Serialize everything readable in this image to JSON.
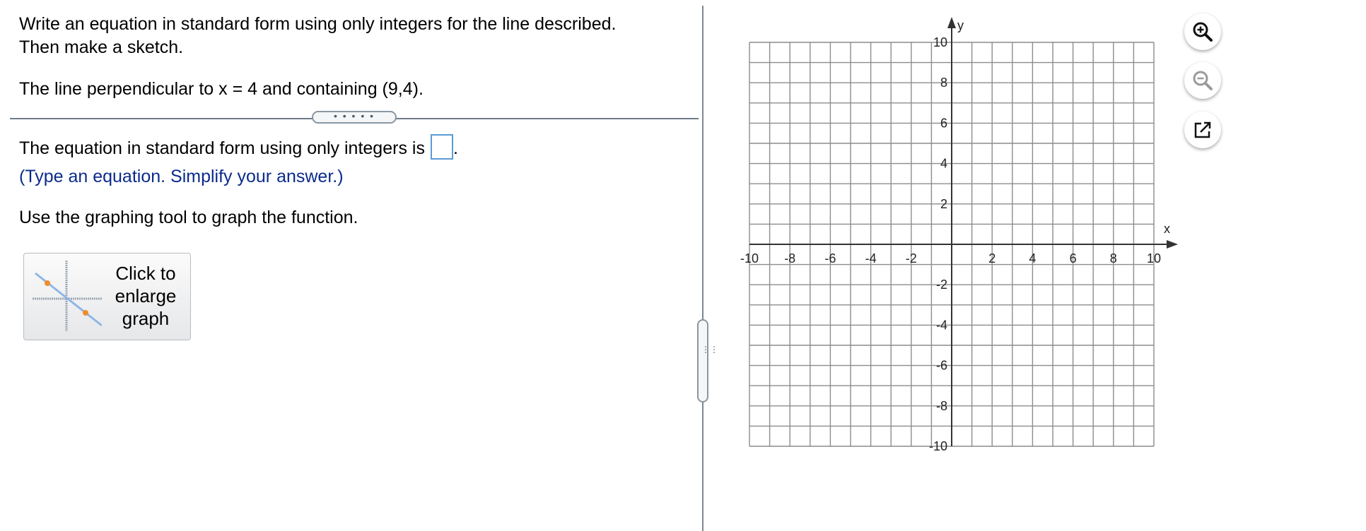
{
  "question": {
    "line1": "Write an equation in standard form using only integers for the line described.",
    "line2": "Then make a sketch.",
    "line3": "The line perpendicular to x = 4 and containing (9,4)."
  },
  "separator": {
    "grip_text": "• • • • •"
  },
  "answer": {
    "prompt": "The equation in standard form using only integers is",
    "suffix": ".",
    "value": "",
    "hint": "(Type an equation. Simplify your answer.)"
  },
  "instruction": "Use the graphing tool to graph the function.",
  "enlarge_button": {
    "label": "Click to\nenlarge\ngraph",
    "icon": "graph-thumbnail-icon"
  },
  "vertical_separator": {
    "grip_text": "⋮⋮"
  },
  "graph": {
    "x_axis_label": "x",
    "y_axis_label": "y",
    "x_range": [
      -10,
      10
    ],
    "y_range": [
      -10,
      10
    ],
    "grid_step": 1,
    "label_step": 2,
    "x_tick_labels": [
      "-10",
      "-8",
      "-6",
      "-4",
      "-2",
      "2",
      "4",
      "6",
      "8",
      "10"
    ],
    "y_tick_labels": [
      "10",
      "8",
      "6",
      "4",
      "2",
      "-2",
      "-4",
      "-6",
      "-8",
      "-10"
    ],
    "grid_color": "#8c8c8c",
    "axis_color": "#333333"
  },
  "tools": [
    {
      "name": "zoom-in",
      "icon": "zoom-in-icon"
    },
    {
      "name": "zoom-out",
      "icon": "zoom-out-icon"
    },
    {
      "name": "open-new-window",
      "icon": "external-link-icon"
    }
  ]
}
